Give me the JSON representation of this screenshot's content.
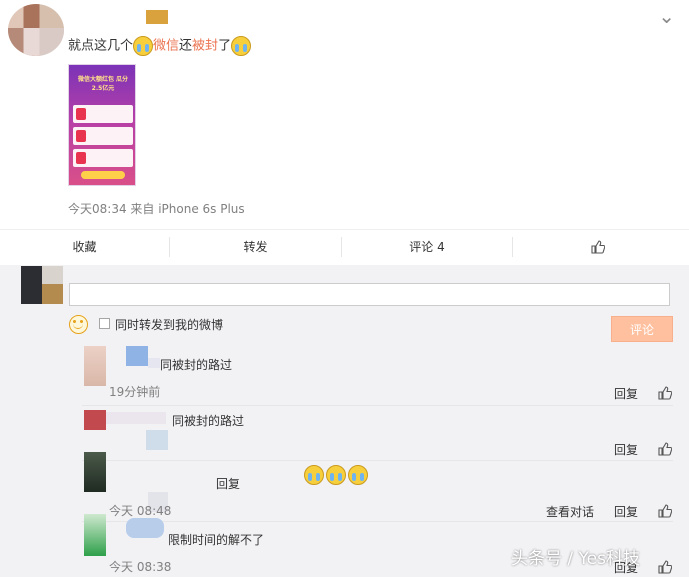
{
  "post": {
    "text_before": "就点这几个",
    "link_1": "微信",
    "text_middle": "还",
    "link_2": "被封",
    "text_after": "了",
    "emoji_icon": "crying-face-icon",
    "image_banner": "微信大额红包 瓜分2.5亿元",
    "meta": "今天08:34 来自 iPhone 6s Plus"
  },
  "actions": {
    "favorite": "收藏",
    "repost": "转发",
    "comment": "评论 4",
    "like_icon": "thumbs-up-icon"
  },
  "composer": {
    "placeholder": "",
    "repost_option": "同时转发到我的微博",
    "submit": "评论",
    "submit_color": "#ffc09f"
  },
  "comments": [
    {
      "text": "同被封的路过",
      "time": "19分钟前",
      "reply": "回复"
    },
    {
      "text": "同被封的路过",
      "reply": "回复"
    },
    {
      "text": "回复",
      "time": "今天 08:48",
      "thread": "查看对话",
      "reply": "回复"
    },
    {
      "text": "限制时间的解不了",
      "time": "今天 08:38",
      "reply": "回复"
    }
  ],
  "watermark": "头条号 / Yes科技",
  "colors": {
    "link": "#eb7350",
    "accent": "#ffc09f",
    "background": "#f2f2f5"
  }
}
